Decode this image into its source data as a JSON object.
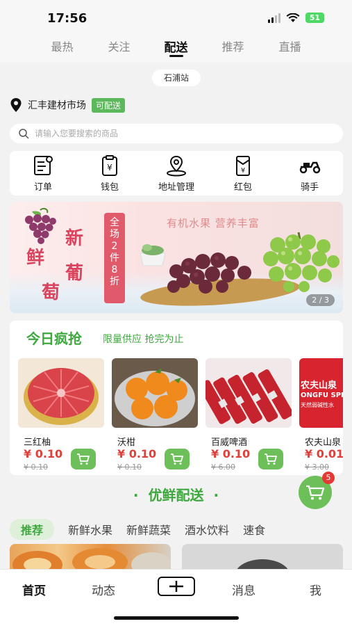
{
  "status_bar": {
    "time": "17:56",
    "battery": "51"
  },
  "top_tabs": [
    {
      "label": "最热"
    },
    {
      "label": "关注"
    },
    {
      "label": "配送"
    },
    {
      "label": "推荐"
    },
    {
      "label": "直播"
    }
  ],
  "active_top_tab": "配送",
  "station": "石浦站",
  "location": {
    "name": "汇丰建材市场",
    "badge": "可配送"
  },
  "search": {
    "placeholder": "请输入您要搜索的商品"
  },
  "quick_menu": [
    {
      "label": "订单",
      "icon": "order-icon"
    },
    {
      "label": "钱包",
      "icon": "wallet-icon"
    },
    {
      "label": "地址管理",
      "icon": "location-icon"
    },
    {
      "label": "红包",
      "icon": "red-envelope-icon"
    },
    {
      "label": "骑手",
      "icon": "scooter-icon"
    }
  ],
  "banner": {
    "title_chars": [
      "新",
      "鲜",
      "葡",
      "萄"
    ],
    "promo": [
      "全",
      "场",
      "2",
      "件",
      "8",
      "折"
    ],
    "slogan": "有机水果 营养丰富",
    "pager": "2 / 3"
  },
  "flash_sale": {
    "title": "今日疯抢",
    "subtitle": "限量供应 抢完为止",
    "products": [
      {
        "name": "三红柚",
        "price": "¥ 0.10",
        "original": "¥ 0.10"
      },
      {
        "name": "沃柑",
        "price": "¥ 0.10",
        "original": "¥ 0.10"
      },
      {
        "name": "百威啤酒",
        "price": "¥ 0.10",
        "original": "¥ 6.00"
      },
      {
        "name": "农夫山泉",
        "price": "¥ 0.01",
        "original": "¥ 3.00"
      }
    ],
    "water_label_1": "农夫山泉",
    "water_label_2": "ONGFU SPRING",
    "water_label_3": "天然弱碱性水"
  },
  "cart": {
    "count": "5"
  },
  "section_heading": "优鲜配送",
  "category_tabs": [
    {
      "label": "推荐"
    },
    {
      "label": "新鲜水果"
    },
    {
      "label": "新鲜蔬菜"
    },
    {
      "label": "酒水饮料"
    },
    {
      "label": "速食"
    }
  ],
  "bottom_nav": {
    "home": "首页",
    "moments": "动态",
    "messages": "消息",
    "me": "我"
  },
  "colors": {
    "accent_green": "#3ea83e",
    "price_red": "#e0403a",
    "cart_green": "#6cbf59",
    "badge_red": "#e53935"
  }
}
